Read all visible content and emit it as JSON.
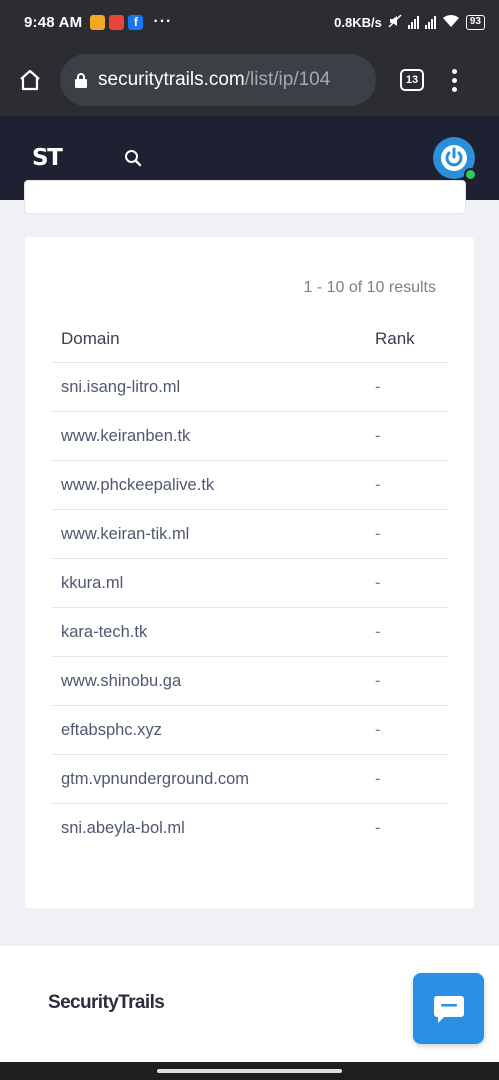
{
  "status_bar": {
    "time": "9:48 AM",
    "network_speed": "0.8KB/s",
    "battery": "93",
    "more": "···"
  },
  "browser": {
    "url_host": "securitytrails.com",
    "url_path": "/list/ip/104",
    "tab_count": "13"
  },
  "site_header": {
    "logo": "ST"
  },
  "results": {
    "count_text": "1 - 10 of 10 results",
    "columns": {
      "domain": "Domain",
      "rank": "Rank"
    },
    "rows": [
      {
        "domain": "sni.isang-litro.ml",
        "rank": "-"
      },
      {
        "domain": "www.keiranben.tk",
        "rank": "-"
      },
      {
        "domain": "www.phckeepalive.tk",
        "rank": "-"
      },
      {
        "domain": "www.keiran-tik.ml",
        "rank": "-"
      },
      {
        "domain": "kkura.ml",
        "rank": "-"
      },
      {
        "domain": "kara-tech.tk",
        "rank": "-"
      },
      {
        "domain": "www.shinobu.ga",
        "rank": "-"
      },
      {
        "domain": "eftabsphc.xyz",
        "rank": "-"
      },
      {
        "domain": "gtm.vpnunderground.com",
        "rank": "-"
      },
      {
        "domain": "sni.abeyla-bol.ml",
        "rank": "-"
      }
    ]
  },
  "footer": {
    "brand": "SecurityTrails"
  },
  "colors": {
    "header_bg": "#1d2131",
    "browser_bg": "#2b2d31",
    "chat_button": "#2b8fe3",
    "link_text": "#4f5871"
  }
}
